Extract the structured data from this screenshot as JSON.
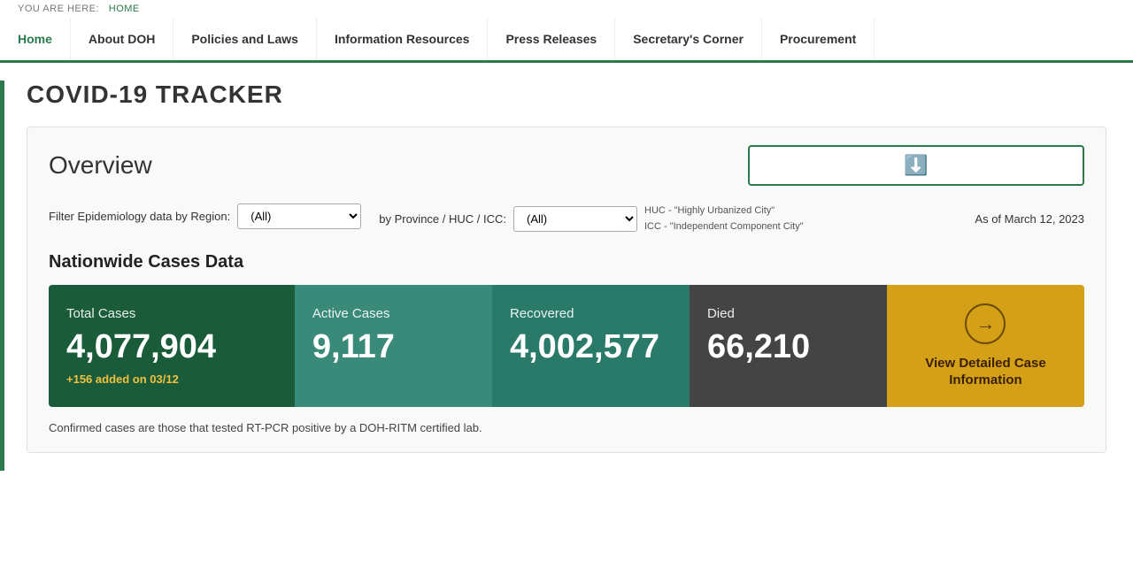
{
  "breadcrumb": {
    "prefix": "YOU ARE HERE:",
    "home": "HOME"
  },
  "nav": {
    "items": [
      {
        "id": "home",
        "label": "Home"
      },
      {
        "id": "about-doh",
        "label": "About DOH"
      },
      {
        "id": "policies-laws",
        "label": "Policies and Laws"
      },
      {
        "id": "information-resources",
        "label": "Information Resources"
      },
      {
        "id": "press-releases",
        "label": "Press Releases"
      },
      {
        "id": "secretarys-corner",
        "label": "Secretary's Corner"
      },
      {
        "id": "procurement",
        "label": "Procurement"
      }
    ]
  },
  "page": {
    "title": "COVID-19 TRACKER"
  },
  "overview": {
    "title": "Overview",
    "filter_region_label": "Filter Epidemiology data by Region:",
    "filter_region_value": "(All)",
    "filter_province_label": "by Province / HUC / ICC:",
    "filter_province_value": "(All)",
    "huc_note": "HUC - \"Highly Urbanized City\"",
    "icc_note": "ICC - \"Independent Component City\"",
    "date_label": "As of March 12, 2023"
  },
  "nationwide": {
    "title": "Nationwide Cases Data",
    "total_cases_label": "Total Cases",
    "total_cases_value": "4,077,904",
    "total_cases_delta": "+156 added on 03/12",
    "active_cases_label": "Active Cases",
    "active_cases_value": "9,117",
    "recovered_label": "Recovered",
    "recovered_value": "4,002,577",
    "died_label": "Died",
    "died_value": "66,210",
    "view_label": "View Detailed Case Information",
    "view_arrow": "→",
    "confirmed_note": "Confirmed cases are those that tested RT-PCR positive by a DOH-RITM certified lab."
  }
}
